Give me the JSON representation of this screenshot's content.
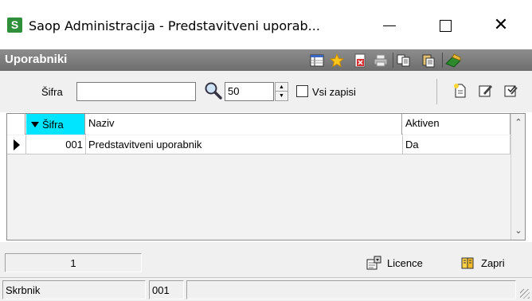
{
  "window": {
    "app_icon_letter": "S",
    "title": "Saop Administracija - Predstavitveni uporab..."
  },
  "header": {
    "title": "Uporabniki",
    "toolbar_icons": [
      "column-chooser-icon",
      "star-icon",
      "delete-record-icon",
      "print-icon",
      "copy-records-icon",
      "paste-record-icon",
      "exit-icon"
    ]
  },
  "filter": {
    "sifra_label": "Šifra",
    "sifra_value": "",
    "limit_value": "50",
    "all_records_label": "Vsi zapisi",
    "all_records_checked": false
  },
  "grid": {
    "columns": [
      "Šifra",
      "Naziv",
      "Aktiven"
    ],
    "sorted_column": "Šifra",
    "rows": [
      {
        "sifra": "001",
        "naziv": "Predstavitveni uporabnik",
        "aktiven": "Da"
      }
    ]
  },
  "bottom": {
    "record_count": "1",
    "licence_label": "Licence",
    "close_label": "Zapri"
  },
  "status": {
    "user": "Skrbnik",
    "code": "001",
    "extra": ""
  },
  "colors": {
    "header_bg": "#7a7a7a",
    "sorted_column_bg": "#00e5ff",
    "logo_green": "#2f8f3a"
  }
}
